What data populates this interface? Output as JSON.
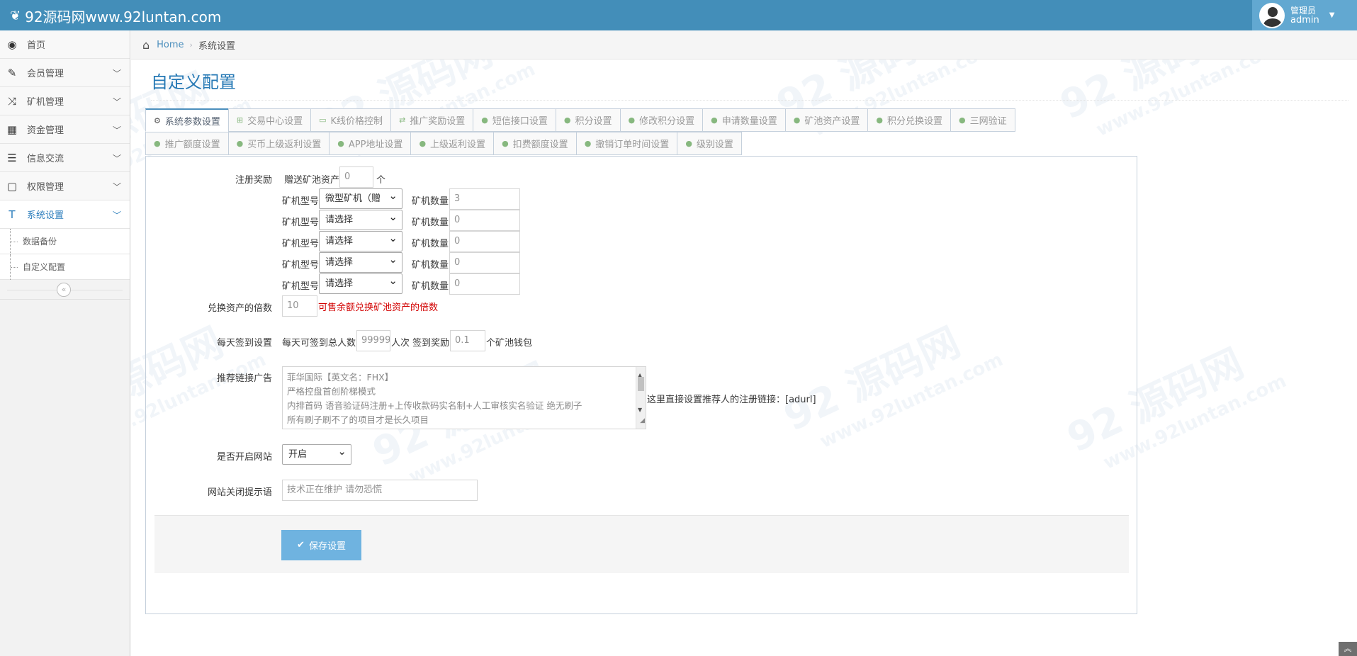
{
  "app": {
    "brand": "92源码网www.92luntan.com",
    "user_role": "管理员",
    "user_name": "admin"
  },
  "watermark": {
    "main": "92 源码网",
    "url": "www.92luntan.com"
  },
  "sidebar": {
    "items": [
      {
        "label": "首页",
        "icon": "dashboard-icon"
      },
      {
        "label": "会员管理",
        "icon": "edit-icon"
      },
      {
        "label": "矿机管理",
        "icon": "shuffle-icon"
      },
      {
        "label": "资金管理",
        "icon": "calendar-icon"
      },
      {
        "label": "信息交流",
        "icon": "list-icon"
      },
      {
        "label": "权限管理",
        "icon": "file-icon"
      },
      {
        "label": "系统设置",
        "icon": "text-icon"
      }
    ],
    "sub_items": [
      {
        "label": "数据备份"
      },
      {
        "label": "自定义配置"
      }
    ]
  },
  "breadcrumb": {
    "home": "Home",
    "current": "系统设置"
  },
  "page": {
    "title": "自定义配置"
  },
  "tabs": {
    "row1": [
      "系统参数设置",
      "交易中心设置",
      "K线价格控制",
      "推广奖励设置",
      "短信接口设置",
      "积分设置",
      "修改积分设置",
      "申请数量设置",
      "矿池资产设置",
      "积分兑换设置",
      "三网验证"
    ],
    "row2": [
      "推广额度设置",
      "买币上级返利设置",
      "APP地址设置",
      "上级返利设置",
      "扣费额度设置",
      "撤销订单时间设置",
      "级别设置"
    ]
  },
  "form": {
    "register_reward": {
      "label": "注册奖励",
      "prefix": "赠送矿池资产",
      "value": "0",
      "suffix": "个",
      "model_label": "矿机型号",
      "count_label": "矿机数量",
      "rows": [
        {
          "model": "微型矿机（赠",
          "count": "3"
        },
        {
          "model": "请选择",
          "count": "0"
        },
        {
          "model": "请选择",
          "count": "0"
        },
        {
          "model": "请选择",
          "count": "0"
        },
        {
          "model": "请选择",
          "count": "0"
        }
      ]
    },
    "exchange_multiple": {
      "label": "兑换资产的倍数",
      "value": "10",
      "hint": "可售余额兑换矿池资产的倍数"
    },
    "daily_checkin": {
      "label": "每天签到设置",
      "total_label": "每天可签到总人数",
      "total_value": "99999",
      "times_label": "人次 签到奖励",
      "reward_value": "0.1",
      "reward_suffix": "个矿池钱包"
    },
    "referral_ad": {
      "label": "推荐链接广告",
      "lines": [
        "菲华国际【英文名：FHX】",
        "严格控盘首创阶梯模式",
        "内排首码 语音验证码注册+上传收款码实名制+人工审核实名验证 绝无刷子",
        "所有刷子刷不了的项目才是长久项目"
      ],
      "note": "这里直接设置推荐人的注册链接：[adurl]"
    },
    "site_open": {
      "label": "是否开启网站",
      "value": "开启"
    },
    "site_closed_msg": {
      "label": "网站关闭提示语",
      "placeholder": "技术正在维护 请勿恐慌"
    },
    "save_label": "保存设置"
  }
}
